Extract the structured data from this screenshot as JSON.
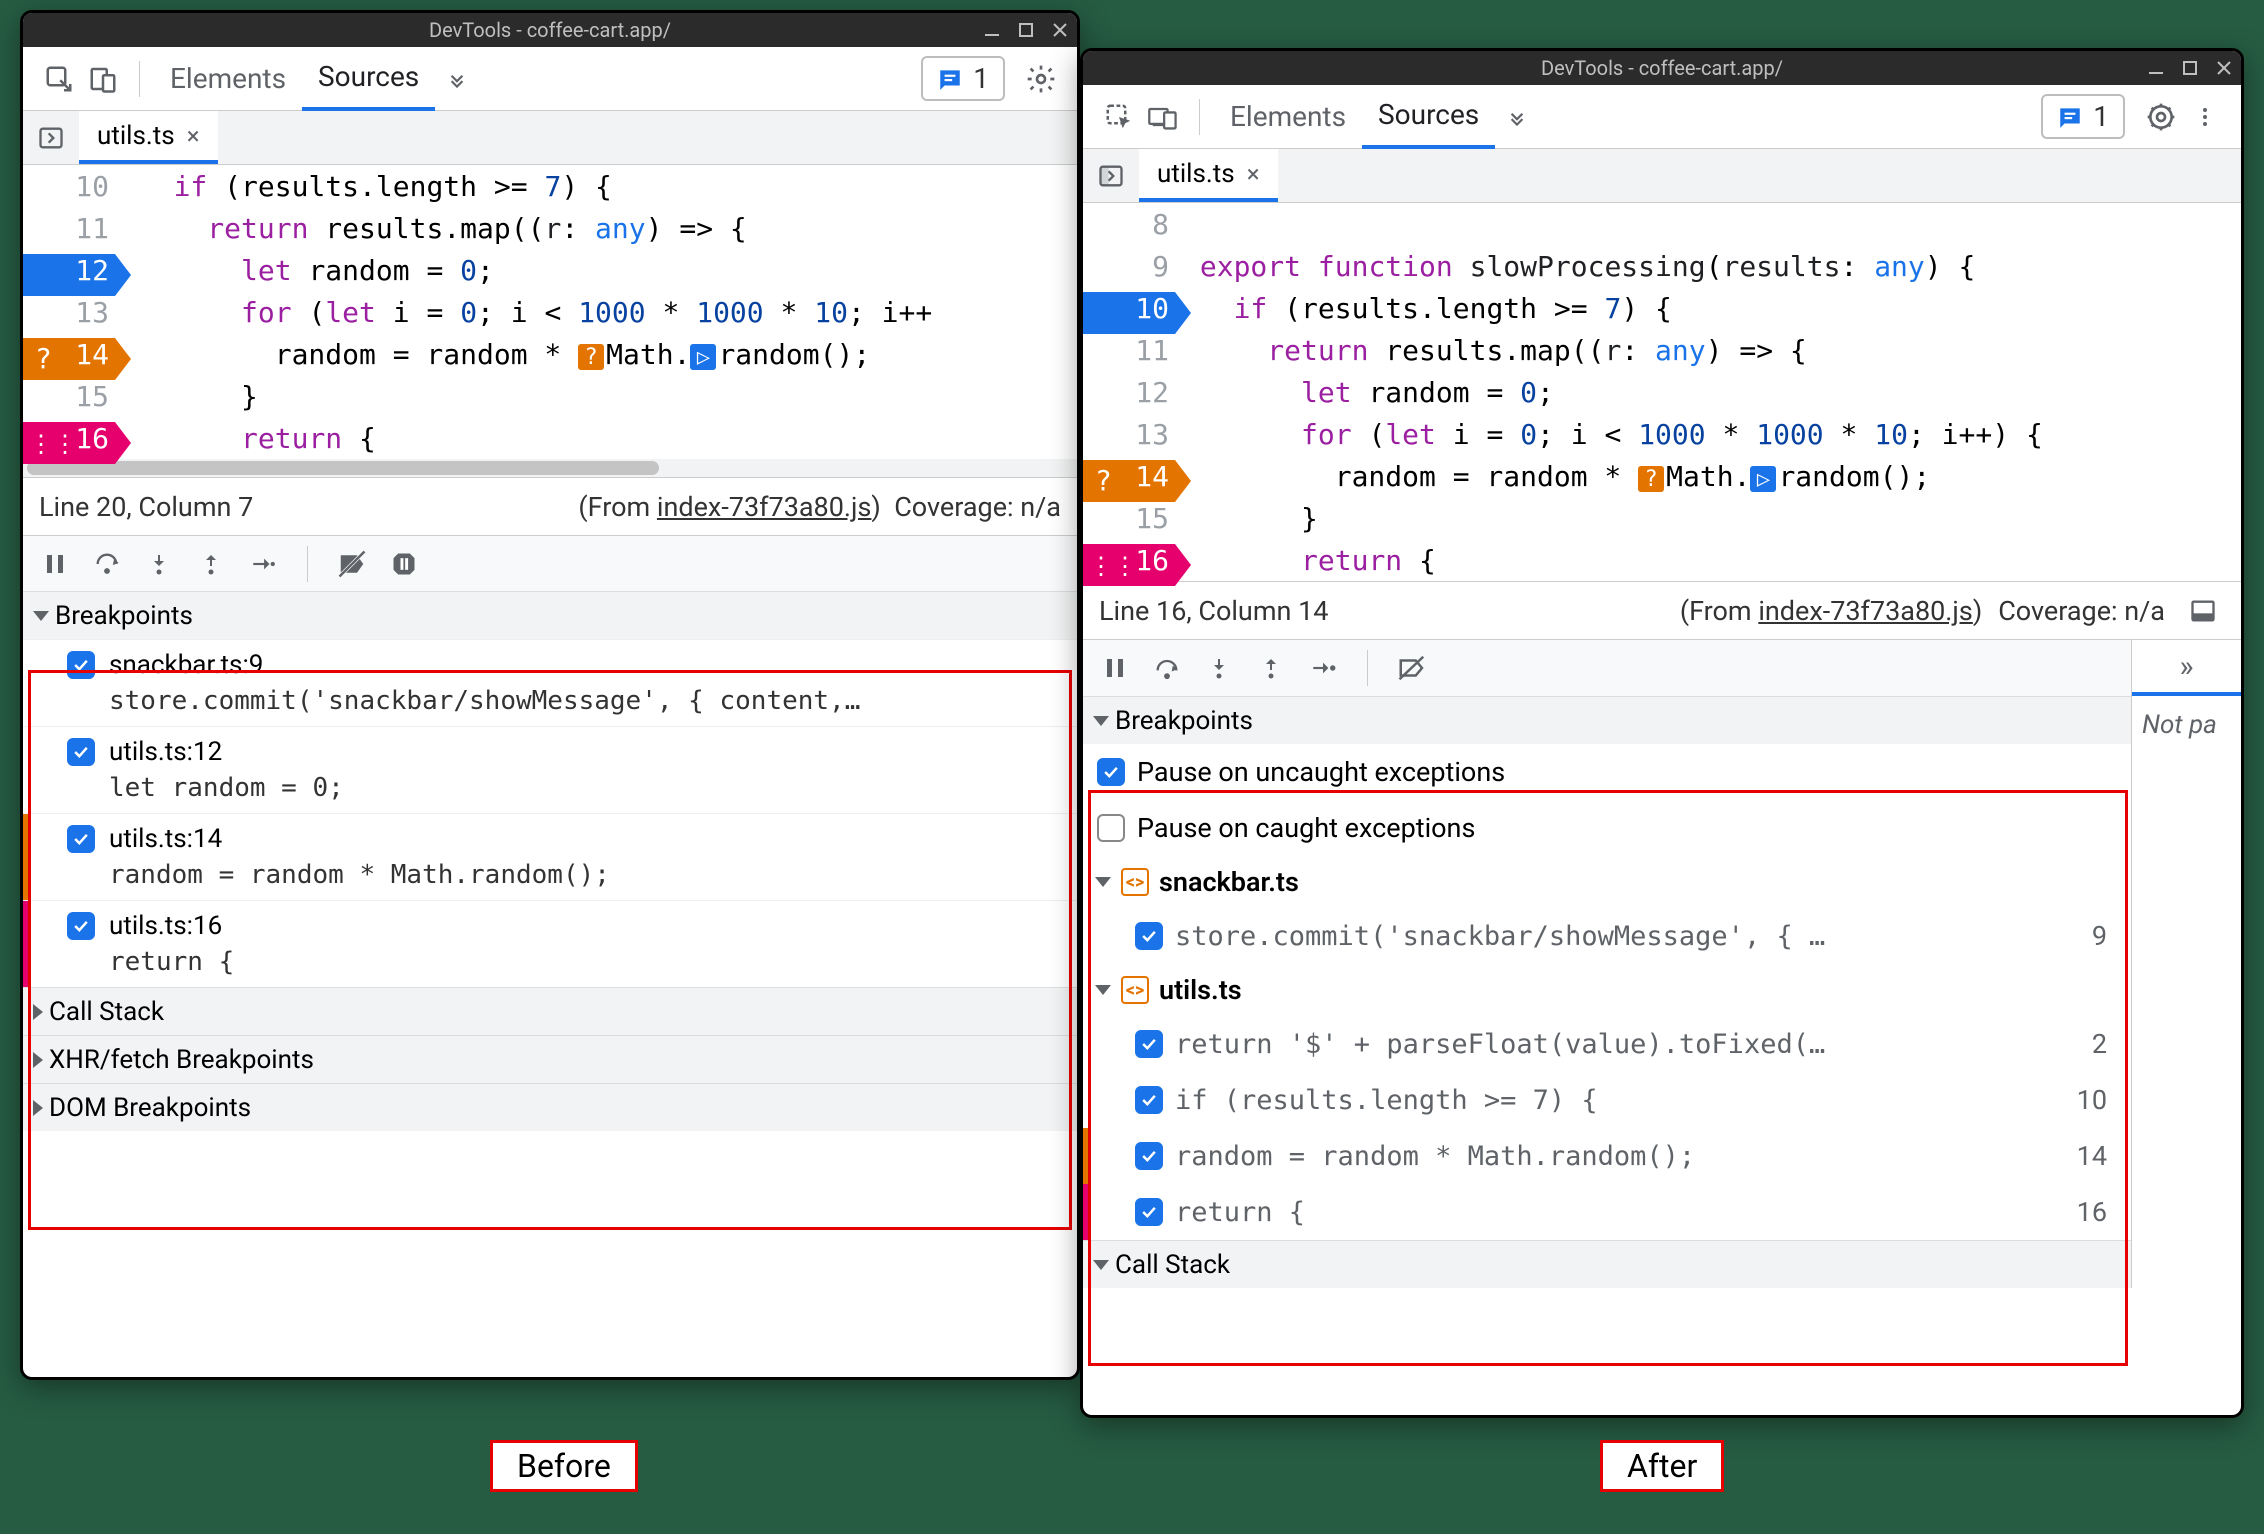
{
  "win_title": "DevTools - coffee-cart.app/",
  "tabs": {
    "elements": "Elements",
    "sources": "Sources"
  },
  "badge_count": "1",
  "file_tab": "utils.ts",
  "before": {
    "status_line": "Line 20, Column 7",
    "status_from_prefix": "(From ",
    "status_from_link": "index-73f73a80.js",
    "status_from_suffix": ")",
    "coverage": "Coverage: n/a",
    "bp_header": "Breakpoints",
    "bps": [
      {
        "title": "snackbar.ts:9",
        "code": "store.commit('snackbar/showMessage', { content,…"
      },
      {
        "title": "utils.ts:12",
        "code": "let random = 0;"
      },
      {
        "title": "utils.ts:14",
        "code": "random = random * Math.random();",
        "stripe": "#e37400"
      },
      {
        "title": "utils.ts:16",
        "code": "return {",
        "stripe": "#e5006e"
      }
    ],
    "panels": {
      "callstack": "Call Stack",
      "xhr": "XHR/fetch Breakpoints",
      "dom": "DOM Breakpoints"
    }
  },
  "after": {
    "status_line": "Line 16, Column 14",
    "status_from_prefix": "(From ",
    "status_from_link": "index-73f73a80.js",
    "status_from_suffix": ")",
    "coverage": "Coverage: n/a",
    "bp_header": "Breakpoints",
    "pause_uncaught": "Pause on uncaught exceptions",
    "pause_caught": "Pause on caught exceptions",
    "group1": {
      "name": "snackbar.ts",
      "items": [
        {
          "code": "store.commit('snackbar/showMessage', { …",
          "line": "9"
        }
      ]
    },
    "group2": {
      "name": "utils.ts",
      "items": [
        {
          "code": "return '$' + parseFloat(value).toFixed(…",
          "line": "2"
        },
        {
          "code": "if (results.length >= 7) {",
          "line": "10"
        },
        {
          "code": "random = random * Math.random();",
          "line": "14",
          "stripe": "#e37400"
        },
        {
          "code": "return {",
          "line": "16",
          "stripe": "#e5006e"
        }
      ]
    },
    "callstack": "Call Stack",
    "not_paused": "Not pa"
  },
  "labels": {
    "before": "Before",
    "after": "After"
  }
}
